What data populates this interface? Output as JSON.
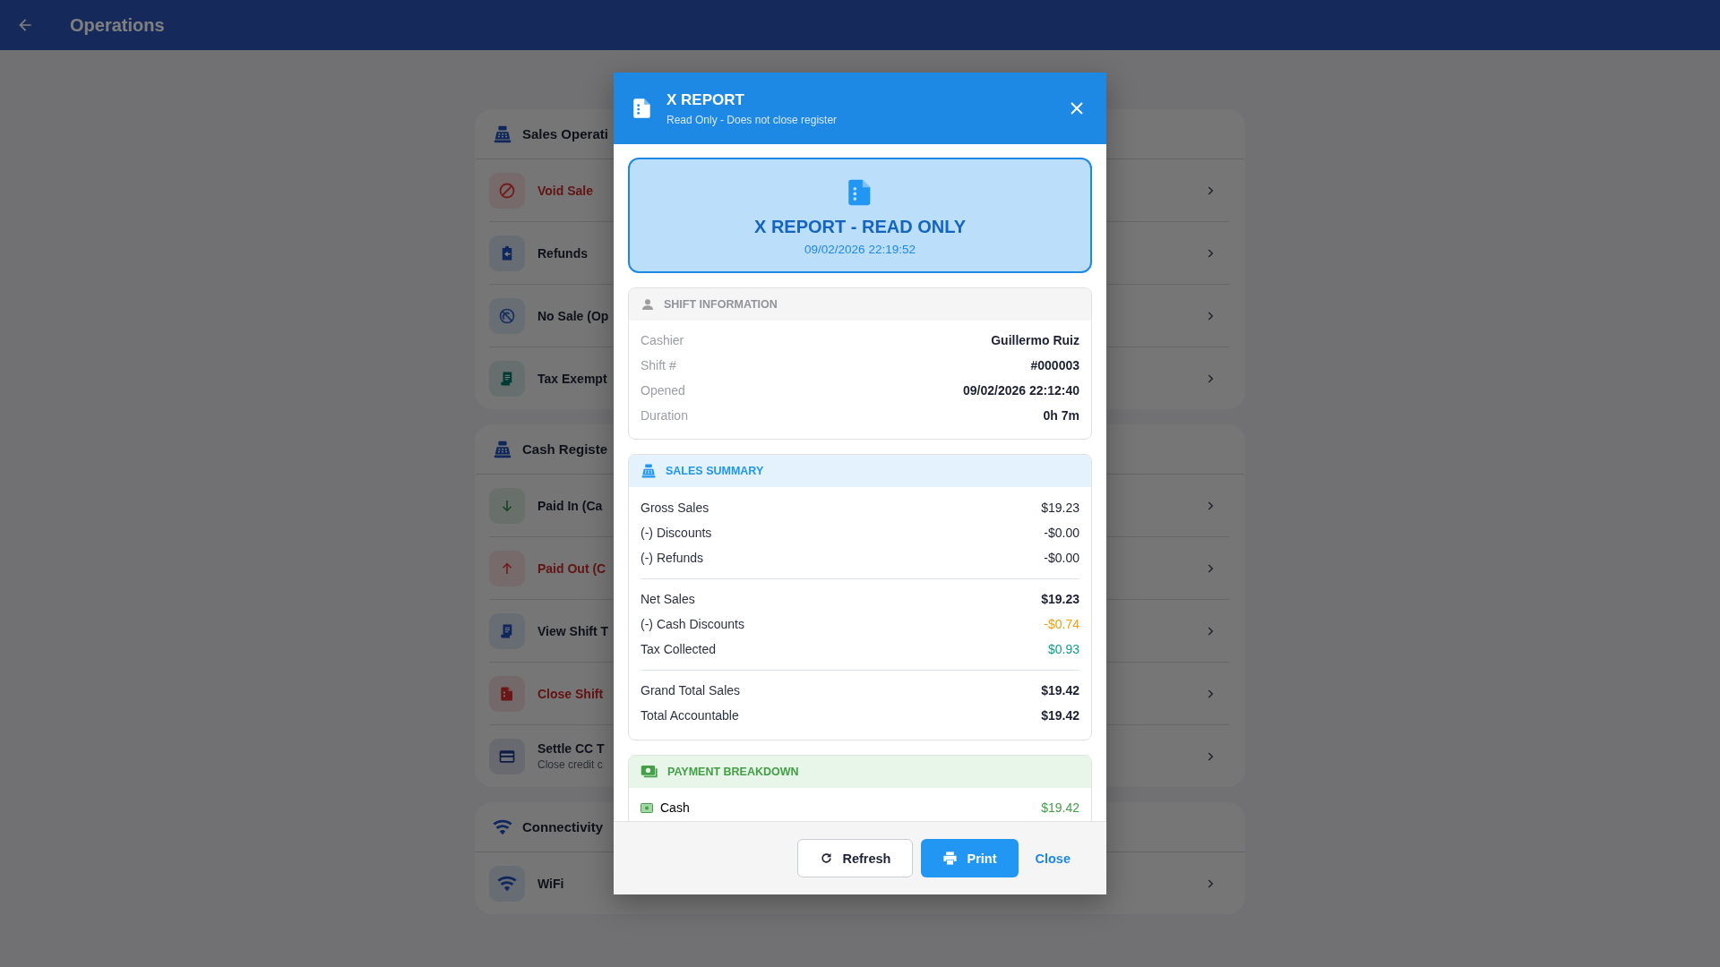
{
  "top_bar": {
    "title": "Operations"
  },
  "sections": [
    {
      "title": "Sales Operati",
      "items": [
        {
          "label": "Void Sale",
          "danger": true
        },
        {
          "label": "Refunds",
          "danger": false
        },
        {
          "label": "No Sale (Op",
          "danger": false
        },
        {
          "label": "Tax Exempt",
          "danger": false
        }
      ]
    },
    {
      "title": "Cash Registe",
      "items": [
        {
          "label": "Paid In (Ca",
          "danger": false
        },
        {
          "label": "Paid Out (C",
          "danger": true
        },
        {
          "label": "View Shift T",
          "danger": false
        },
        {
          "label": "Close Shift",
          "danger": true
        },
        {
          "label": "Settle CC T",
          "subtitle": "Close credit c",
          "danger": false
        }
      ]
    },
    {
      "title": "Connectivity",
      "items": [
        {
          "label": "WiFi",
          "danger": false
        }
      ]
    }
  ],
  "modal": {
    "title": "X REPORT",
    "subtitle": "Read Only - Does not close register",
    "banner": {
      "title": "X REPORT - READ ONLY",
      "timestamp": "09/02/2026 22:19:52"
    },
    "shift_information": {
      "title": "SHIFT INFORMATION",
      "rows": [
        {
          "label": "Cashier",
          "value": "Guillermo Ruiz"
        },
        {
          "label": "Shift #",
          "value": "#000003"
        },
        {
          "label": "Opened",
          "value": "09/02/2026 22:12:40"
        },
        {
          "label": "Duration",
          "value": "0h 7m"
        }
      ]
    },
    "sales_summary": {
      "title": "SALES SUMMARY",
      "groups": [
        [
          {
            "label": "Gross Sales",
            "value": "$19.23",
            "kind": "plain"
          },
          {
            "label": "(-) Discounts",
            "value": "-$0.00",
            "kind": "plain"
          },
          {
            "label": "(-) Refunds",
            "value": "-$0.00",
            "kind": "plain"
          }
        ],
        [
          {
            "label": "Net Sales",
            "value": "$19.23",
            "kind": "total"
          },
          {
            "label": "(-) Cash Discounts",
            "value": "-$0.74",
            "kind": "deduction"
          },
          {
            "label": "Tax Collected",
            "value": "$0.93",
            "kind": "tax"
          }
        ],
        [
          {
            "label": "Grand Total Sales",
            "value": "$19.42",
            "kind": "total"
          },
          {
            "label": "Total Accountable",
            "value": "$19.42",
            "kind": "total"
          }
        ]
      ]
    },
    "payment_breakdown": {
      "title": "PAYMENT BREAKDOWN",
      "rows": [
        {
          "label": "Cash",
          "value": "$19.42"
        }
      ]
    },
    "buttons": [
      {
        "label": "Refresh",
        "kind": "outlined"
      },
      {
        "label": "Print",
        "kind": "primary"
      },
      {
        "label": "Close",
        "kind": "text"
      }
    ]
  }
}
